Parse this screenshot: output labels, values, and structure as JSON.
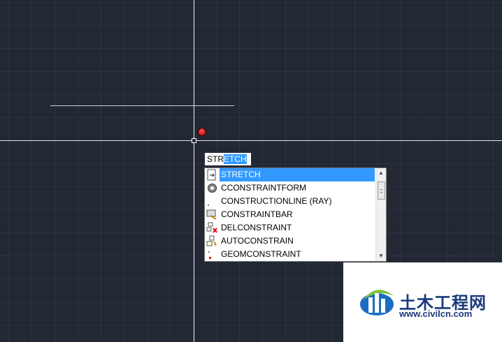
{
  "command_input": {
    "prefix": "STR",
    "highlighted": "ETCH"
  },
  "autocomplete": {
    "items": [
      {
        "label": "STRETCH",
        "icon": "stretch-icon",
        "selected": true
      },
      {
        "label": "CCONSTRAINTFORM",
        "icon": "gear-icon",
        "selected": false
      },
      {
        "label": "CONSTRUCTIONLINE (RAY)",
        "icon": "construction-line-icon",
        "selected": false
      },
      {
        "label": "CONSTRAINTBAR",
        "icon": "constraint-bar-icon",
        "selected": false
      },
      {
        "label": "DELCONSTRAINT",
        "icon": "delete-constraint-icon",
        "selected": false
      },
      {
        "label": "AUTOCONSTRAIN",
        "icon": "auto-constrain-icon",
        "selected": false
      },
      {
        "label": "GEOMCONSTRAINT",
        "icon": "geom-constraint-icon",
        "selected": false
      }
    ]
  },
  "watermark": {
    "title": "土木工程网",
    "url": "www.civilcn.com"
  },
  "colors": {
    "background": "#222834",
    "grid": "#2c3342",
    "selection": "#3399ff",
    "marker": "#e00000"
  }
}
